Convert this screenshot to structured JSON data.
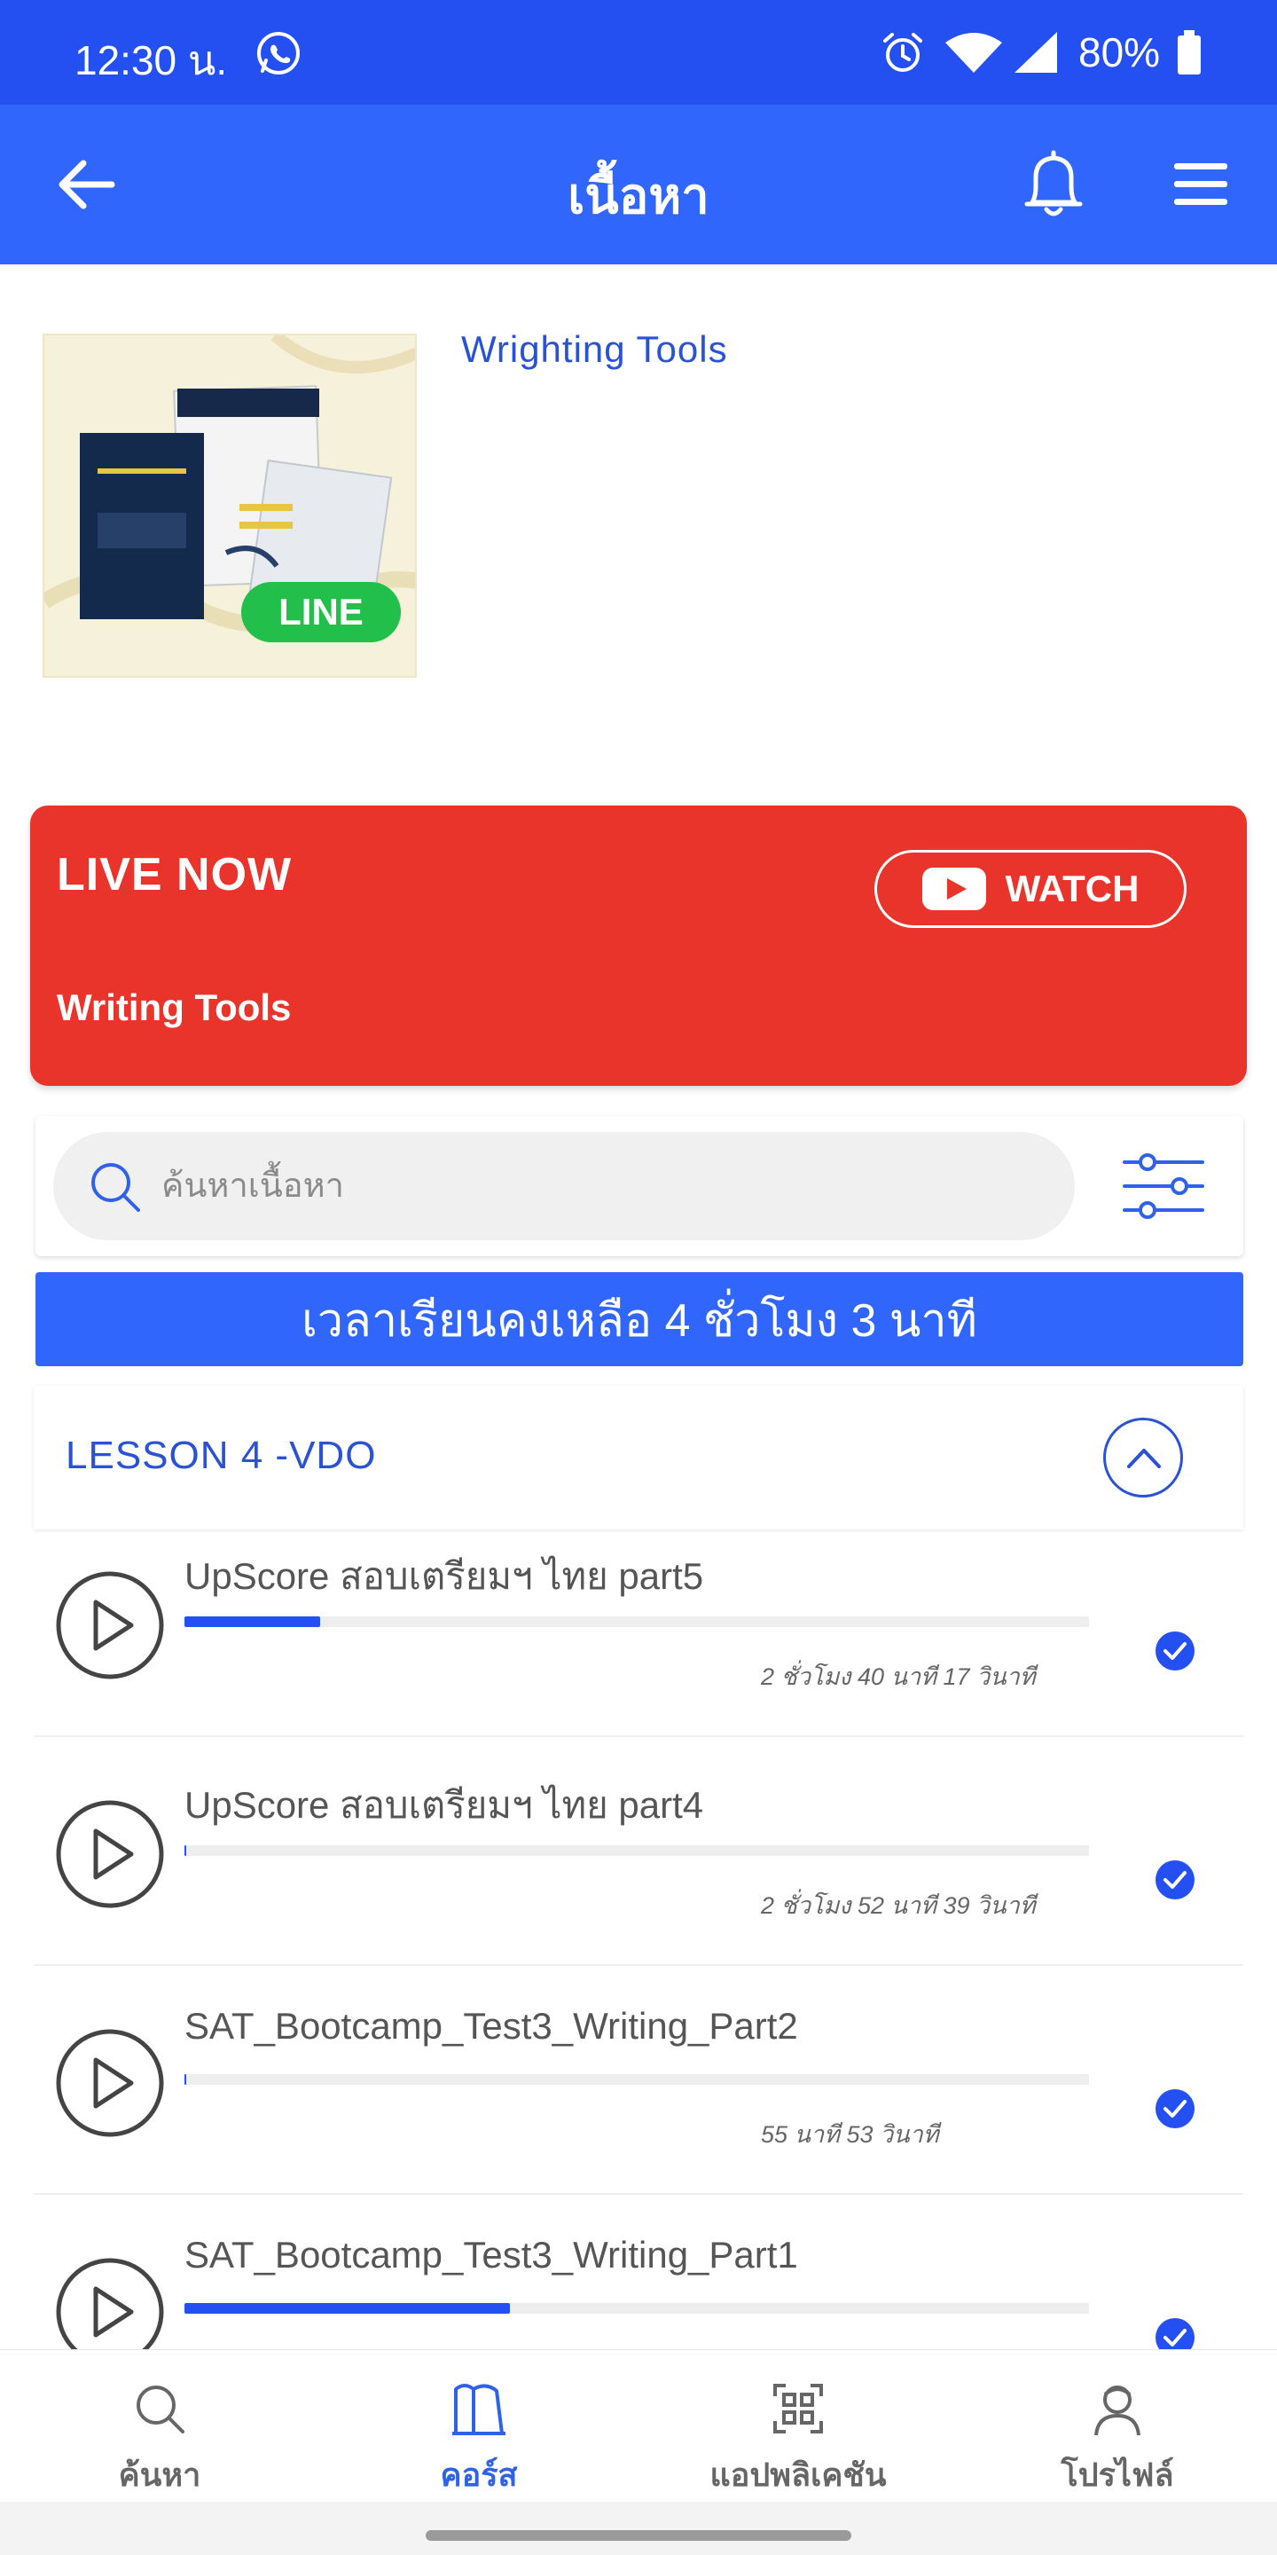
{
  "status_bar": {
    "time": "12:30 น.",
    "battery": "80%",
    "icons": [
      "whatsapp-icon",
      "alarm-icon",
      "wifi-icon",
      "signal-icon",
      "battery-icon"
    ]
  },
  "app_bar": {
    "title": "เนื้อหา",
    "icons": [
      "back-arrow-icon",
      "bell-icon",
      "menu-icon"
    ]
  },
  "course": {
    "title": "Wrighting Tools",
    "thumbnail_badge": "LINE"
  },
  "live": {
    "label": "LIVE NOW",
    "subtitle": "Writing Tools",
    "watch_label": "WATCH"
  },
  "search": {
    "placeholder": "ค้นหาเนื้อหา"
  },
  "time_remaining": "เวลาเรียนคงเหลือ 4 ชั่วโมง 3 นาที",
  "lesson": {
    "title": "LESSON 4 -VDO",
    "items": [
      {
        "title": "UpScore สอบเตรียมฯ ไทย part5",
        "progress": 0.15,
        "duration": "2 ชั่วโมง 40 นาที 17 วินาที",
        "completed": true
      },
      {
        "title": "UpScore สอบเตรียมฯ ไทย part4",
        "progress": 0.002,
        "duration": "2 ชั่วโมง 52 นาที 39 วินาที",
        "completed": true
      },
      {
        "title": "SAT_Bootcamp_Test3_Writing_Part2",
        "progress": 0.002,
        "duration": "55 นาที  53 วินาที",
        "completed": true
      },
      {
        "title": "SAT_Bootcamp_Test3_Writing_Part1",
        "progress": 0.36,
        "duration": "",
        "completed": true
      }
    ]
  },
  "bottom_nav": {
    "items": [
      {
        "label": "ค้นหา",
        "icon": "search-icon",
        "active": false
      },
      {
        "label": "คอร์ส",
        "icon": "book-icon",
        "active": true
      },
      {
        "label": "แอปพลิเคชัน",
        "icon": "apps-icon",
        "active": false
      },
      {
        "label": "โปรไฟล์",
        "icon": "profile-icon",
        "active": false
      }
    ]
  },
  "colors": {
    "status_bar": "#2450f2",
    "app_bar": "#3066fb",
    "live_card": "#e8342a",
    "accent": "#2a52d6"
  }
}
